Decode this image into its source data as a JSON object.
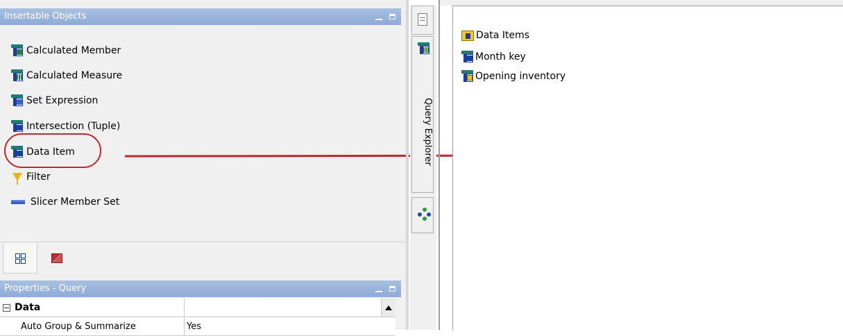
{
  "insertable_objects": {
    "title": "Insertable Objects",
    "items": [
      {
        "label": "Calculated Member",
        "icon": "calculated-member-icon"
      },
      {
        "label": "Calculated Measure",
        "icon": "calculated-measure-icon"
      },
      {
        "label": "Set Expression",
        "icon": "set-expression-icon"
      },
      {
        "label": "Intersection (Tuple)",
        "icon": "intersection-tuple-icon"
      },
      {
        "label": "Data Item",
        "icon": "data-item-icon"
      },
      {
        "label": "Filter",
        "icon": "filter-icon"
      },
      {
        "label": "Slicer Member Set",
        "icon": "slicer-member-set-icon"
      }
    ]
  },
  "bottom_tabs": [
    {
      "icon": "query-tree-icon",
      "active": true
    },
    {
      "icon": "toolbox-icon",
      "active": false
    }
  ],
  "properties": {
    "title": "Properties - Query",
    "group_label": "Data",
    "rows": [
      {
        "name": "Auto Group & Summarize",
        "value": "Yes"
      }
    ]
  },
  "query_explorer": {
    "label": "Query Explorer"
  },
  "data_items": {
    "root_label": "Data Items",
    "children": [
      {
        "label": "Month key",
        "icon": "data-item-icon"
      },
      {
        "label": "Opening inventory",
        "icon": "measure-item-icon"
      }
    ]
  },
  "colors": {
    "panel_title_bg": "#8eabd6",
    "annotation_red": "#c0262c"
  }
}
